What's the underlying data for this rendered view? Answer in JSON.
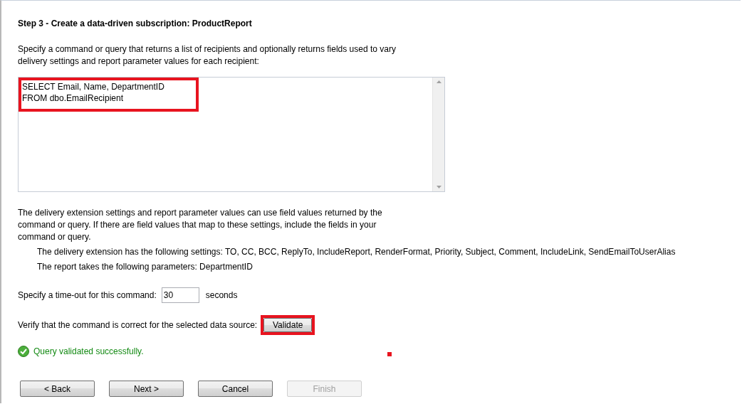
{
  "title": "Step 3 - Create a data-driven subscription: ProductReport",
  "intro": "Specify a command or query that returns a list of recipients and optionally returns fields used to vary delivery settings and report parameter values for each recipient:",
  "query": {
    "lines": [
      "SELECT Email, Name, DepartmentID",
      "FROM dbo.EmailRecipient"
    ],
    "highlighted": true
  },
  "explanation": "The delivery extension settings and report parameter values can use field values returned by the command or query. If there are field values that map to these settings, include the fields in your command or query.",
  "details": [
    "The delivery extension has the following settings: TO, CC, BCC, ReplyTo, IncludeReport, RenderFormat, Priority, Subject, Comment, IncludeLink, SendEmailToUserAlias",
    "The report takes the following parameters: DepartmentID"
  ],
  "timeout": {
    "label": "Specify a time-out for this command:",
    "value": "30",
    "unit": "seconds"
  },
  "verify": {
    "label": "Verify that the command is correct for the selected data source:",
    "button": "Validate",
    "highlighted": true
  },
  "status": {
    "text": "Query validated successfully.",
    "kind": "success"
  },
  "buttons": [
    {
      "label": "< Back",
      "disabled": false
    },
    {
      "label": "Next >",
      "disabled": false
    },
    {
      "label": "Cancel",
      "disabled": false
    },
    {
      "label": "Finish",
      "disabled": true
    }
  ]
}
